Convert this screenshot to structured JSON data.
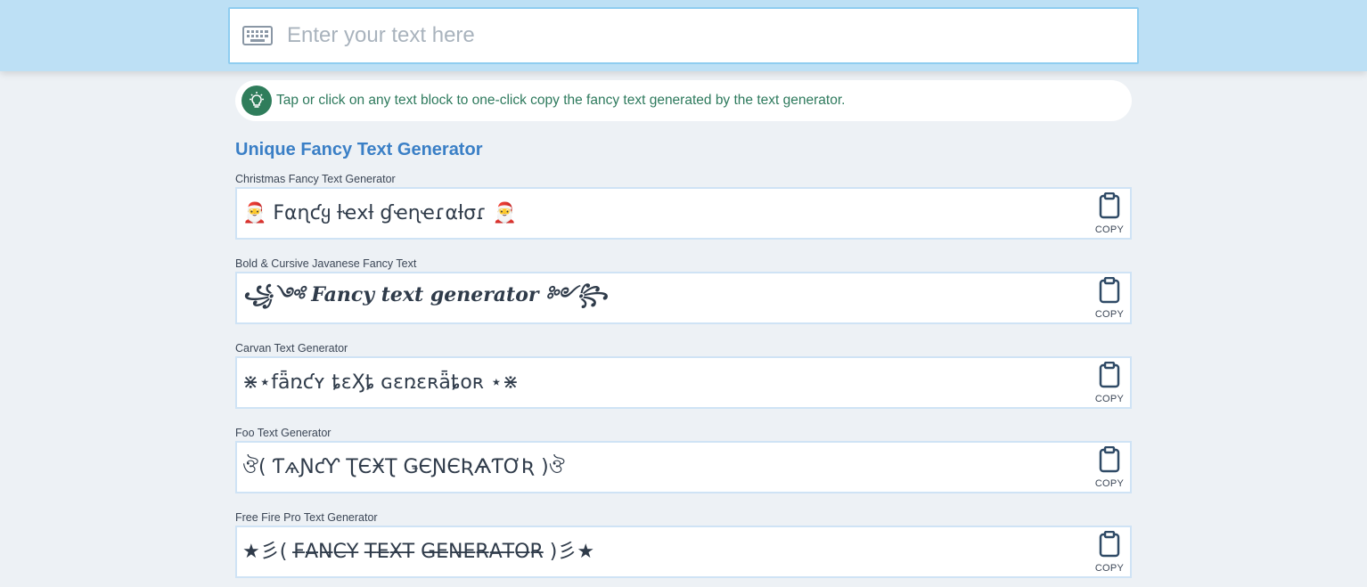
{
  "search": {
    "placeholder": "Enter your text here",
    "icon": "keyboard-icon"
  },
  "tip": {
    "icon": "lightbulb-icon",
    "text": "Tap or click on any text block to one-click copy the fancy text generated by the text generator."
  },
  "section": {
    "title": "Unique Fancy Text Generator"
  },
  "generators": [
    {
      "label": "Christmas Fancy Text Generator",
      "text": "🎅 Fαɳƈყ ƚҽxƚ ɠҽɳҽɾαƚσɾ 🎅",
      "copy_label": "COPY"
    },
    {
      "label": "Bold & Cursive Javanese Fancy Text",
      "text": "꧁༺ Fancy text generator ༻꧂",
      "copy_label": "COPY"
    },
    {
      "label": "Carvan Text Generator",
      "text": "⋇⋆fǟռƈʏ ȶɛӼȶ ɢɛռɛʀǟȶօʀ ⋆⋇",
      "copy_label": "COPY"
    },
    {
      "label": "Foo Text Generator",
      "text": "ঔ( ƬѧƝƈƳ ƮЄӾƮ ǤЄƝЄƦѦƬƠƦ )ঔ",
      "copy_label": "COPY"
    },
    {
      "label": "Free Fire Pro Text Generator",
      "text": "★彡( F̶A̶N̶C̶Y̶ T̶E̶X̶T̶ G̶E̶N̶E̶R̶A̶T̶O̶R̶ )彡★",
      "copy_label": "COPY"
    }
  ],
  "colors": {
    "topbar": "#bde0f5",
    "accent_title": "#3a7fc6",
    "tip_green": "#2f7d5b",
    "card_border": "#cfe3f5"
  }
}
